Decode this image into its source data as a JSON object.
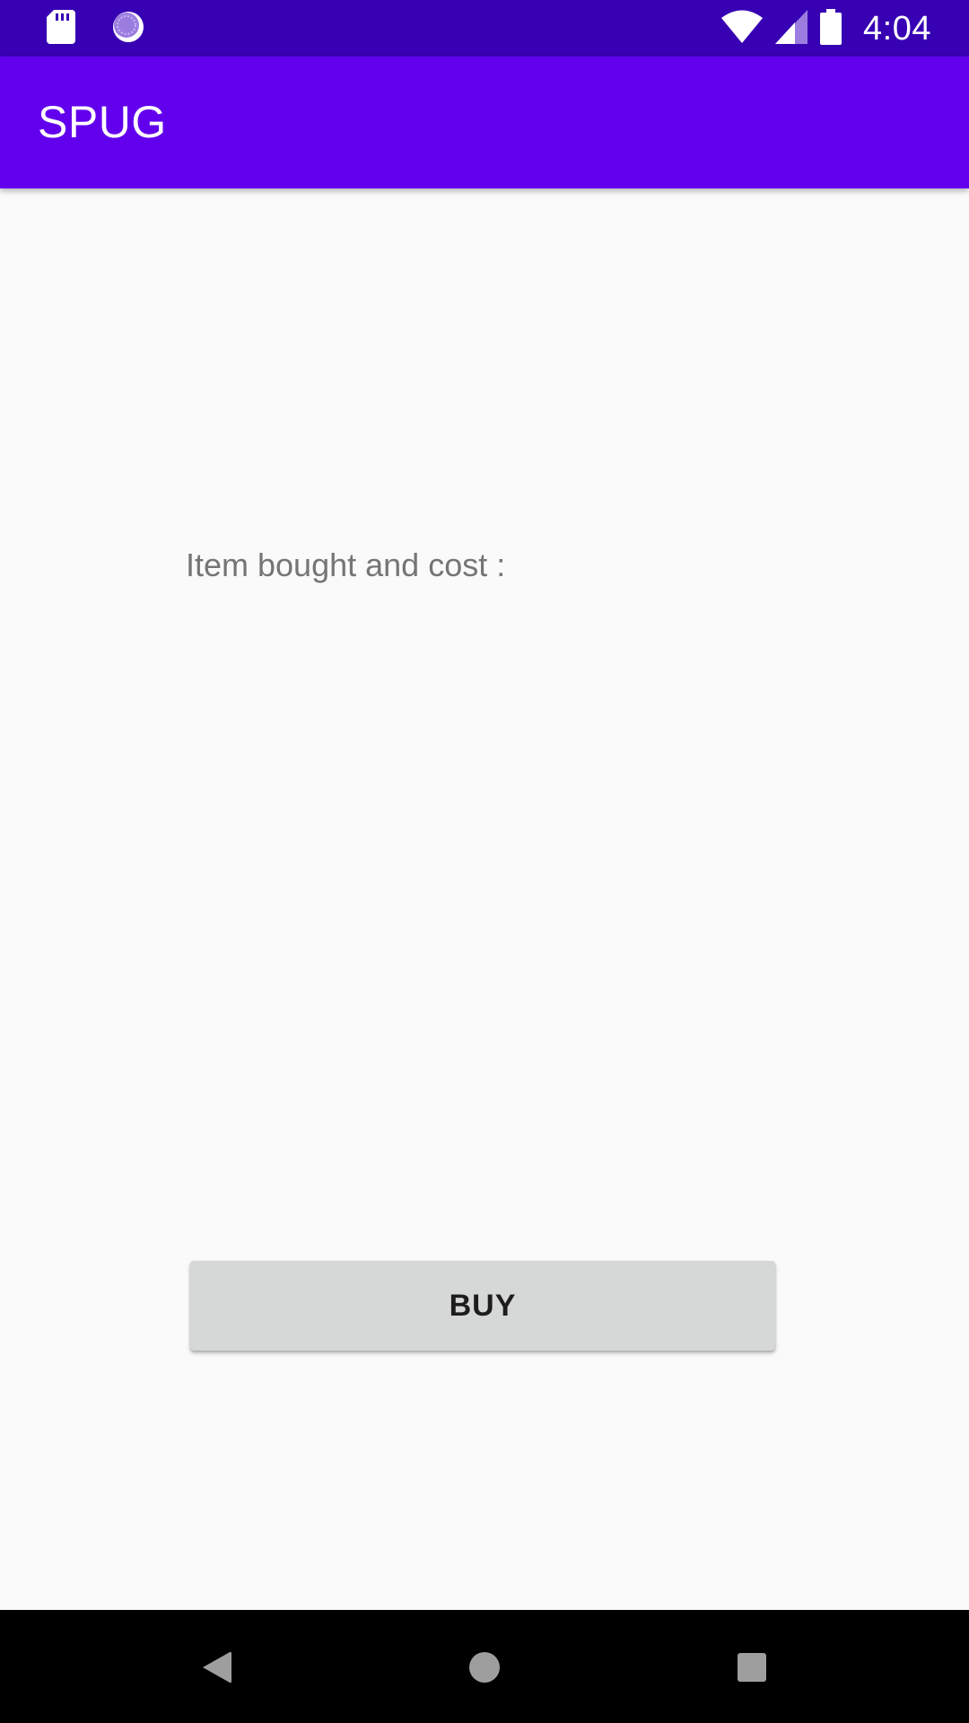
{
  "status_bar": {
    "time": "4:04",
    "icons": [
      "sd-card-icon",
      "sync-icon",
      "wifi-icon",
      "signal-icon",
      "battery-icon"
    ],
    "background": "#3700b3"
  },
  "app_bar": {
    "title": "SPUG",
    "background": "#6200ee"
  },
  "main": {
    "item_label": "Item bought and cost :",
    "buy_button_label": "BUY"
  },
  "nav_bar": {
    "buttons": [
      "back-icon",
      "home-icon",
      "recents-icon"
    ]
  }
}
